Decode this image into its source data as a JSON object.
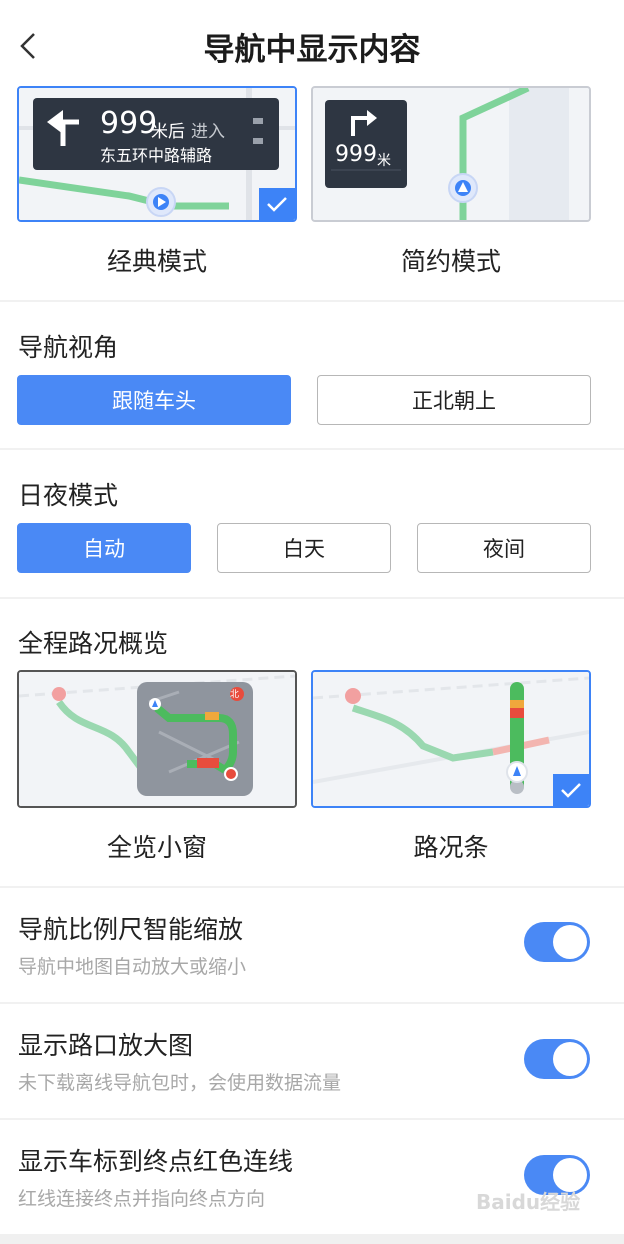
{
  "header": {
    "title": "导航中显示内容"
  },
  "display_mode": {
    "options": [
      {
        "label": "经典模式",
        "selected": true,
        "preview": {
          "distance": "999",
          "unit": "米后",
          "action": "进入",
          "road": "东五环中路辅路"
        }
      },
      {
        "label": "简约模式",
        "selected": false,
        "preview": {
          "distance": "999",
          "unit": "米"
        }
      }
    ]
  },
  "view_angle": {
    "title": "导航视角",
    "options": [
      {
        "label": "跟随车头",
        "active": true
      },
      {
        "label": "正北朝上",
        "active": false
      }
    ]
  },
  "day_night": {
    "title": "日夜模式",
    "options": [
      {
        "label": "自动",
        "active": true
      },
      {
        "label": "白天",
        "active": false
      },
      {
        "label": "夜间",
        "active": false
      }
    ]
  },
  "overview": {
    "title": "全程路况概览",
    "options": [
      {
        "label": "全览小窗",
        "selected": false
      },
      {
        "label": "路况条",
        "selected": true
      }
    ],
    "north_label": "北"
  },
  "settings": [
    {
      "title": "导航比例尺智能缩放",
      "desc": "导航中地图自动放大或缩小",
      "enabled": true
    },
    {
      "title": "显示路口放大图",
      "desc": "未下载离线导航包时，会使用数据流量",
      "enabled": true
    },
    {
      "title": "显示车标到终点红色连线",
      "desc": "红线连接终点并指向终点方向",
      "enabled": true
    }
  ],
  "watermark": "Baidu经验",
  "colors": {
    "accent": "#4a89f5",
    "route_green": "#4cbb5e",
    "route_red": "#e84c3d",
    "route_yellow": "#f0a83c"
  }
}
